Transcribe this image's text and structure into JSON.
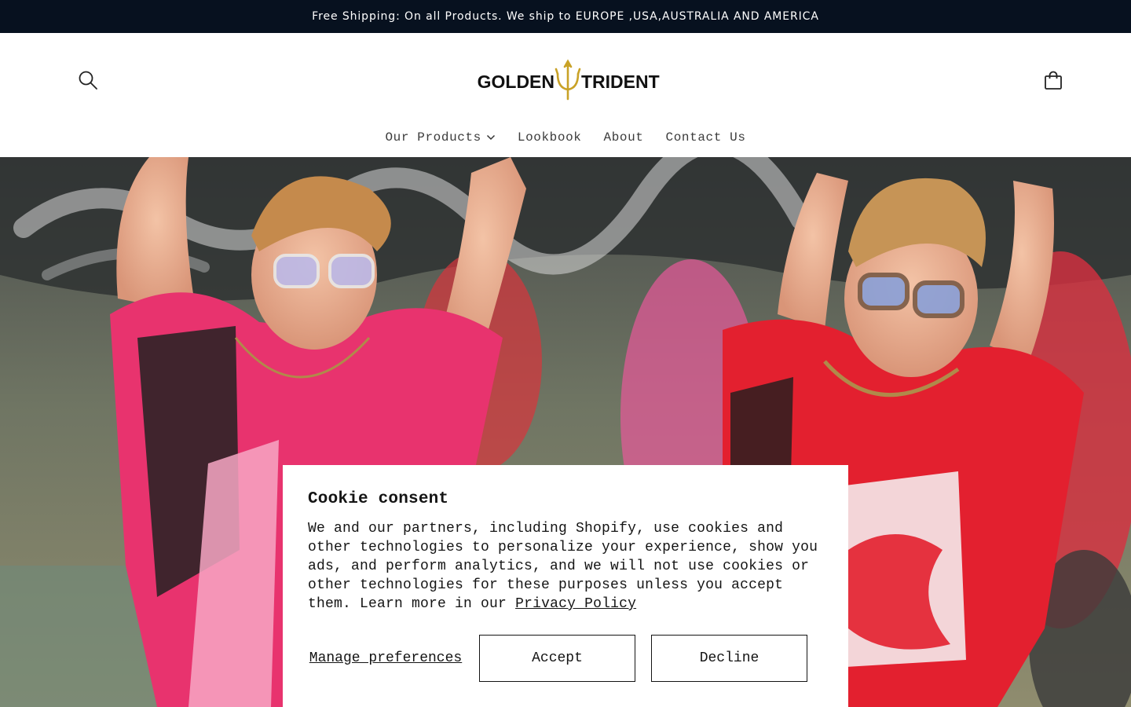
{
  "announcement": {
    "text": "Free Shipping: On all Products. We ship to EUROPE ,USA,AUSTRALIA AND AMERICA"
  },
  "header": {
    "logo": {
      "left_text": "GOLDEN",
      "right_text": "TRIDENT",
      "trident_color": "#c9a227"
    },
    "search_icon": "search-icon",
    "cart_icon": "cart-icon"
  },
  "nav": {
    "items": [
      {
        "label": "Our Products",
        "has_dropdown": true
      },
      {
        "label": "Lookbook"
      },
      {
        "label": "About"
      },
      {
        "label": "Contact Us"
      }
    ]
  },
  "cookie": {
    "title": "Cookie consent",
    "body": "We and our partners, including Shopify, use cookies and other technologies to personalize your experience, show you ads, and perform analytics, and we will not use cookies or other technologies for these purposes unless you accept them. Learn more in our",
    "privacy_link": "Privacy Policy",
    "manage_label": "Manage preferences",
    "accept_label": "Accept",
    "decline_label": "Decline"
  },
  "colors": {
    "announcement_bg": "#07111f",
    "jersey_pink": "#e8336e",
    "jersey_red": "#e3202f"
  }
}
